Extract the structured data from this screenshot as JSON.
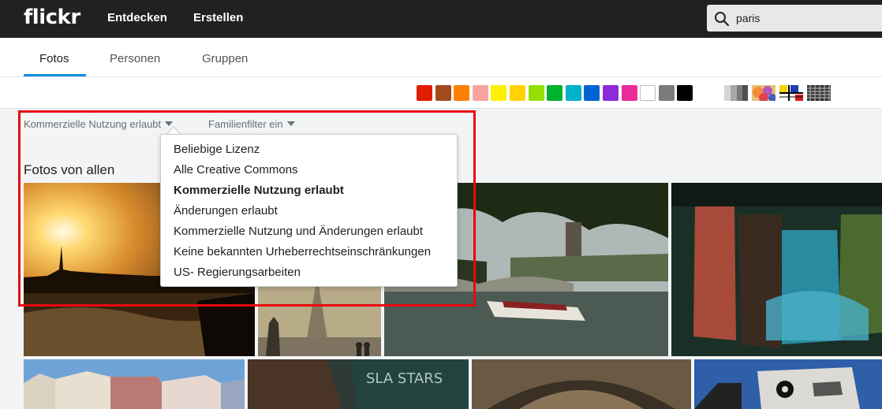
{
  "header": {
    "logo": "flickr",
    "nav": [
      "Entdecken",
      "Erstellen"
    ],
    "search_value": "paris"
  },
  "tabs": [
    {
      "label": "Fotos",
      "active": true
    },
    {
      "label": "Personen",
      "active": false
    },
    {
      "label": "Gruppen",
      "active": false
    }
  ],
  "color_filters": [
    "#e01e00",
    "#a34a1a",
    "#ff7f00",
    "#f9a3a0",
    "#ffef00",
    "#ffd200",
    "#94e000",
    "#00b22d",
    "#00b1c9",
    "#0063d1",
    "#8c2bd9",
    "#ea2d9a",
    "#ffffff",
    "#7b7b7b",
    "#000000"
  ],
  "style_filters": [
    "black-and-white",
    "vibrant-colors",
    "pattern",
    "texture"
  ],
  "filters": {
    "license": "Kommerzielle Nutzung erlaubt",
    "family": "Familienfilter ein"
  },
  "section_title": "Fotos von allen",
  "license_menu": {
    "items": [
      "Beliebige Lizenz",
      "Alle Creative Commons",
      "Kommerzielle Nutzung erlaubt",
      "Änderungen erlaubt",
      "Kommerzielle Nutzung und Änderungen erlaubt",
      "Keine bekannten Urheberrechtseinschränkungen",
      "US- Regierungsarbeiten"
    ],
    "selected_index": 2
  },
  "photos": [
    "paris-sunset",
    "eiffel-tower-fog",
    "seine-boat",
    "water-reflection",
    "paris-buildings",
    "stars-sign",
    "stone-arch",
    "street-art"
  ]
}
